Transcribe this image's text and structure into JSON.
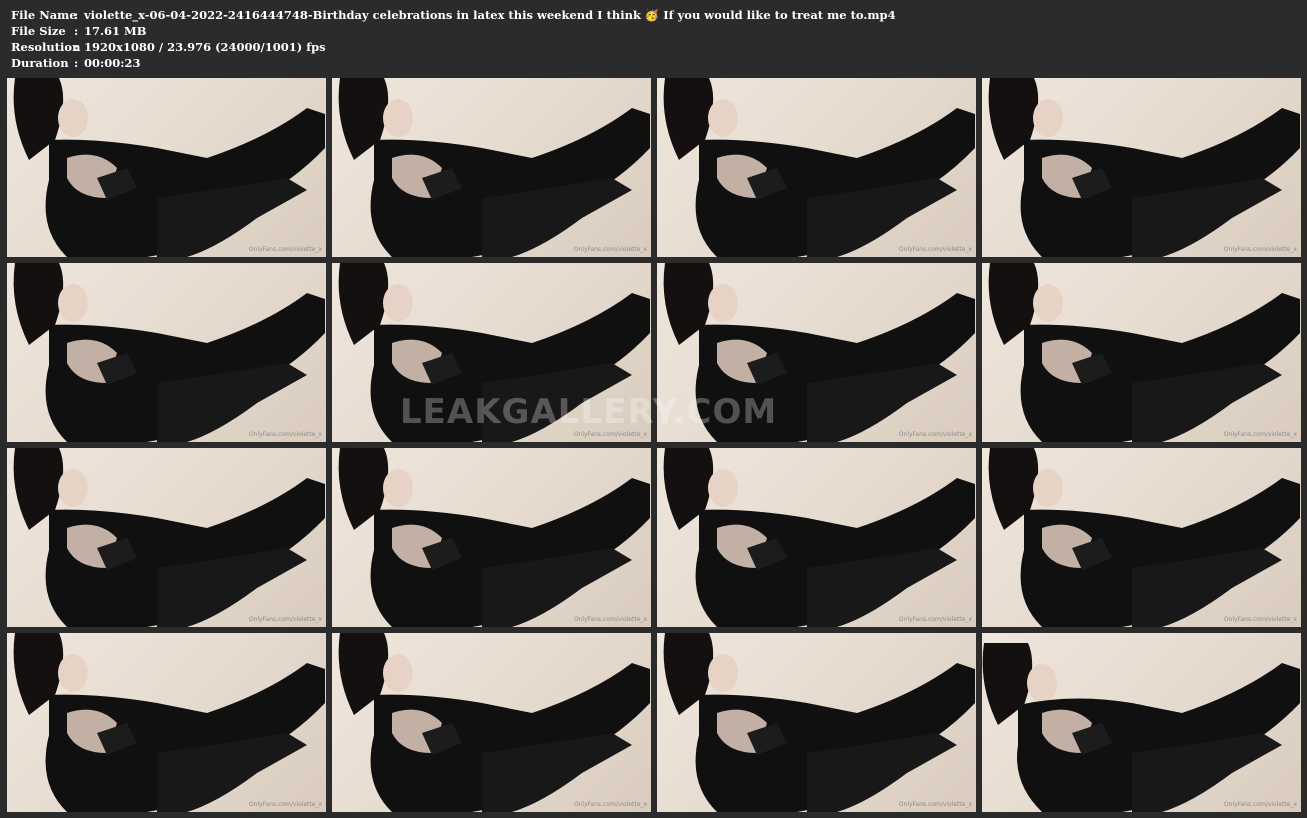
{
  "info": {
    "file_name_label": "File Name",
    "file_name_value": "violette_x-06-04-2022-2416444748-Birthday celebrations in latex this weekend I think 🥳 If you would like to treat me to.mp4",
    "file_size_label": "File Size",
    "file_size_value": "17.61 MB",
    "resolution_label": "Resolution",
    "resolution_value": "1920x1080 / 23.976 (24000/1001) fps",
    "duration_label": "Duration",
    "duration_value": "00:00:23",
    "separator": ":"
  },
  "thumbnail_watermark": "OnlyFans.com/violette_x",
  "overlay_watermark": "LEAKGALLERY.COM",
  "colors": {
    "background": "#2b2b2b",
    "text": "#ffffff",
    "scene_wall": "#e9dfd3",
    "outfit": "#111111"
  }
}
